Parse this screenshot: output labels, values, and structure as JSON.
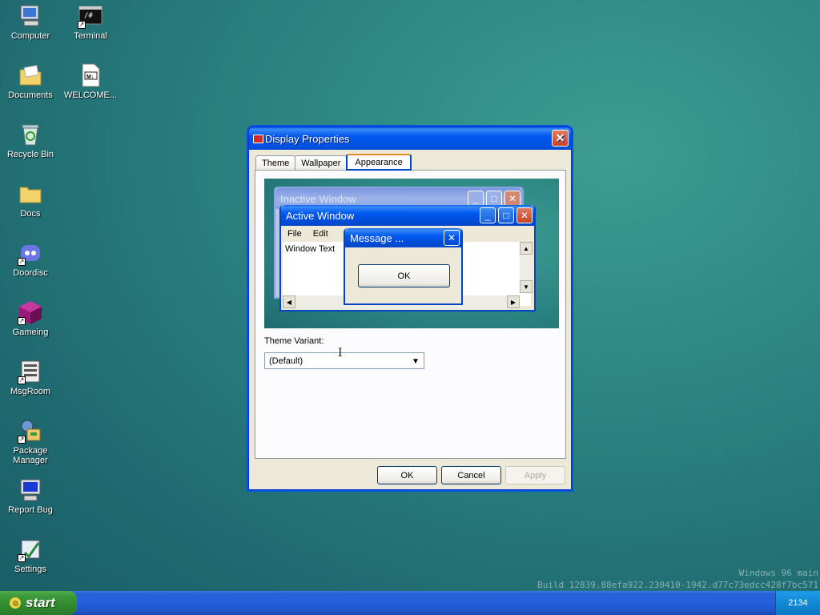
{
  "desktop": {
    "icons": [
      {
        "label": "Computer",
        "icon": "computer-icon"
      },
      {
        "label": "Terminal",
        "icon": "terminal-icon"
      },
      {
        "label": "Documents",
        "icon": "documents-folder-icon"
      },
      {
        "label": "WELCOME...",
        "icon": "markdown-file-icon"
      },
      {
        "label": "Recycle Bin",
        "icon": "recycle-bin-icon"
      },
      {
        "label": "Docs",
        "icon": "folder-icon"
      },
      {
        "label": "Doordisc",
        "icon": "doordisc-icon"
      },
      {
        "label": "Gameing",
        "icon": "game-cube-icon"
      },
      {
        "label": "MsgRoom",
        "icon": "msgroom-icon"
      },
      {
        "label": "Package Manager",
        "icon": "package-manager-icon"
      },
      {
        "label": "Report Bug",
        "icon": "report-bug-icon"
      },
      {
        "label": "Settings",
        "icon": "settings-icon"
      }
    ],
    "terminal_glyph": "/#",
    "md_glyph": "M↓"
  },
  "watermark": {
    "line1": "Windows 96 main",
    "line2": "Build 12839.88efa922.230410-1942.d77c73edcc428f7bc571"
  },
  "taskbar": {
    "start_label": "start",
    "clock": "2134"
  },
  "dialog": {
    "title": "Display Properties",
    "close_glyph": "✕",
    "tabs": [
      "Theme",
      "Wallpaper",
      "Appearance"
    ],
    "active_tab": "Appearance",
    "preview": {
      "inactive_title": "Inactive Window",
      "active_title": "Active Window",
      "menu_file": "File",
      "menu_edit": "Edit",
      "window_text": "Window Text",
      "message_title": "Message ...",
      "ok_label": "OK"
    },
    "theme_variant_label": "Theme Variant:",
    "theme_variant_value": "(Default)",
    "buttons": {
      "ok": "OK",
      "cancel": "Cancel",
      "apply": "Apply"
    }
  },
  "colors": {
    "titlebar_blue": "#0058ee",
    "start_green": "#3d9a3c",
    "close_red": "#c8432a"
  }
}
